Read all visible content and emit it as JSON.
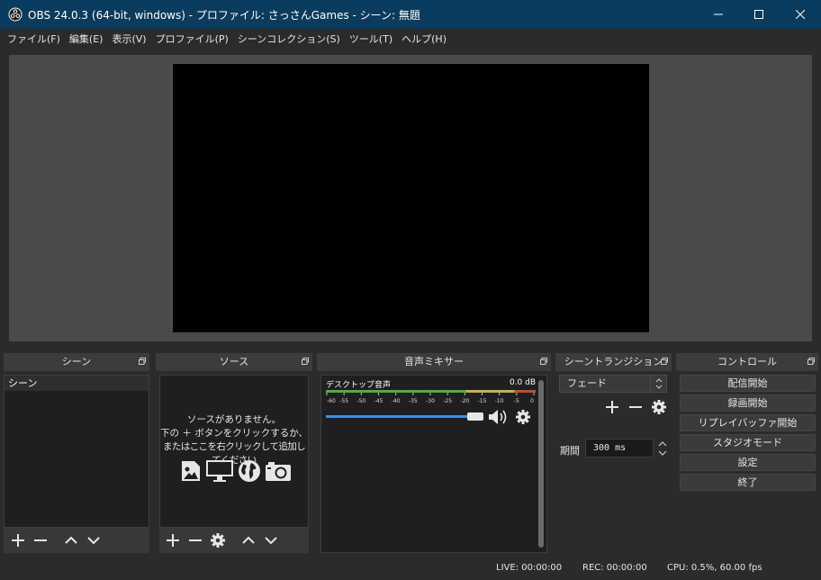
{
  "window": {
    "title": "OBS 24.0.3 (64-bit, windows) - プロファイル: さっさんGames - シーン: 無題",
    "controls": [
      "minimize-icon",
      "maximize-icon",
      "close-icon"
    ]
  },
  "menu": [
    "ファイル(F)",
    "編集(E)",
    "表示(V)",
    "プロファイル(P)",
    "シーンコレクション(S)",
    "ツール(T)",
    "ヘルプ(H)"
  ],
  "docks": {
    "scenes": {
      "title": "シーン",
      "items": [
        "シーン"
      ]
    },
    "sources": {
      "title": "ソース",
      "empty_line1": "ソースがありません。",
      "empty_line2": "下の ＋ ボタンをクリックするか、",
      "empty_line3": "またはここを右クリックして追加してください"
    },
    "mixer": {
      "title": "音声ミキサー",
      "track": {
        "name": "デスクトップ音声",
        "level": "0.0 dB",
        "volume": 1.0
      },
      "scale": [
        "-60",
        "-55",
        "-50",
        "-45",
        "-40",
        "-35",
        "-30",
        "-25",
        "-20",
        "-15",
        "-10",
        "-5",
        "0"
      ]
    },
    "transitions": {
      "title": "シーントランジション",
      "selected": "フェード",
      "duration_label": "期間",
      "duration_value": "300 ms"
    },
    "controls": {
      "title": "コントロール",
      "buttons": [
        "配信開始",
        "録画開始",
        "リプレイバッファ開始",
        "スタジオモード",
        "設定",
        "終了"
      ]
    }
  },
  "status": {
    "live": "LIVE: 00:00:00",
    "rec": "REC: 00:00:00",
    "cpu": "CPU: 0.5%, 60.00 fps"
  },
  "colors": {
    "titlebar": "#0b3c5d",
    "background": "#2b2b2b",
    "preview_bg": "#4a4a4a",
    "volume_fill": "#3d8ee0",
    "meter_green": "#4caf3c",
    "meter_yellow": "#c9b43a",
    "meter_red": "#c84632"
  }
}
